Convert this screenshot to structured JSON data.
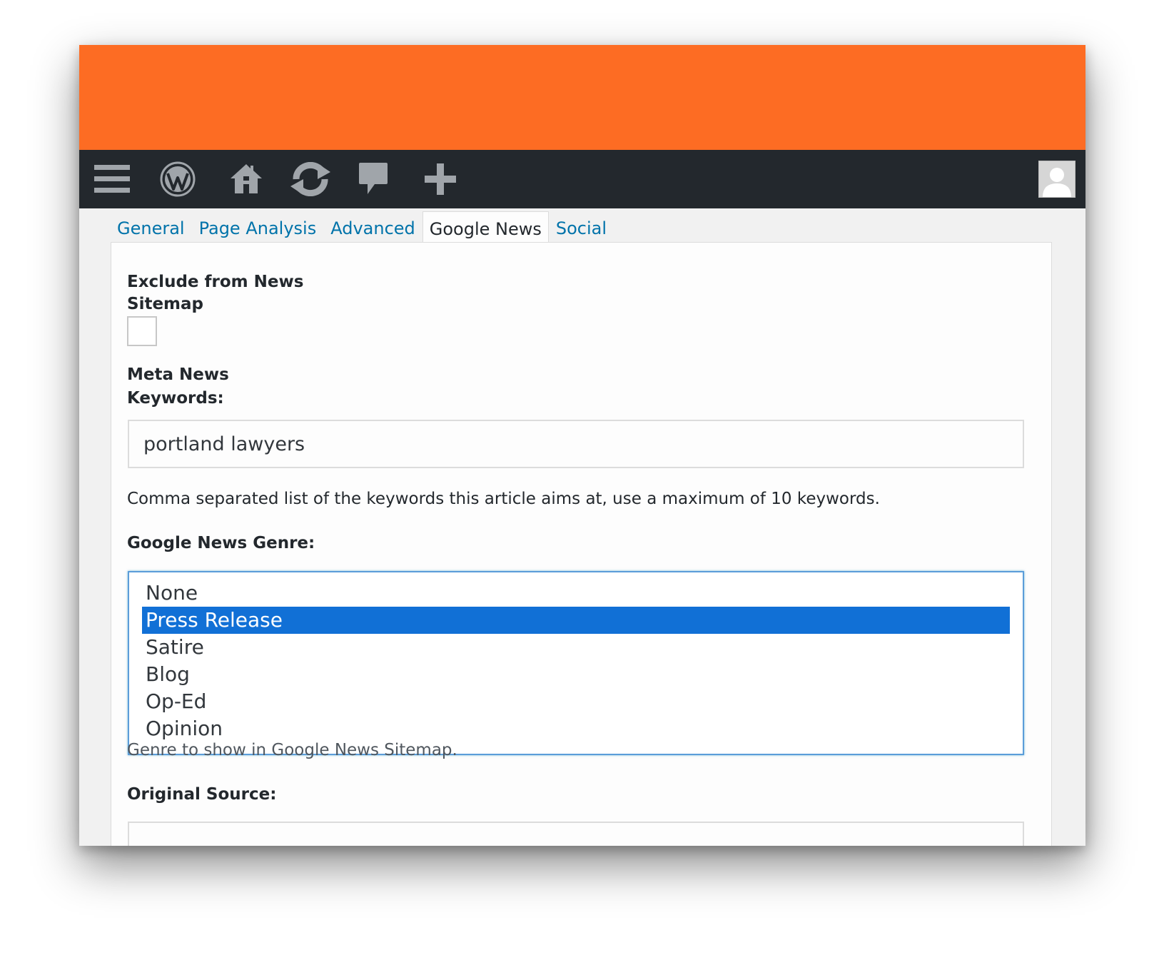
{
  "theme": {
    "brand_orange": "#fd6c23",
    "admin_bar": "#23282d",
    "link_blue": "#0073aa",
    "select_blue": "#1170d6"
  },
  "admin_bar": {
    "icons": [
      "menu-icon",
      "wordpress-logo-icon",
      "home-icon",
      "updates-icon",
      "comments-icon",
      "add-new-icon"
    ],
    "avatar": "user-avatar-icon"
  },
  "tabs": [
    {
      "label": "General",
      "active": false
    },
    {
      "label": "Page Analysis",
      "active": false
    },
    {
      "label": "Advanced",
      "active": false
    },
    {
      "label": "Google News",
      "active": true
    },
    {
      "label": "Social",
      "active": false
    }
  ],
  "form": {
    "exclude_label_line1": "Exclude from News",
    "exclude_label_line2": "Sitemap",
    "exclude_checked": false,
    "keywords_label_line1": "Meta News",
    "keywords_label_line2": "Keywords:",
    "keywords_value": "portland lawyers",
    "keywords_help": "Comma separated list of the keywords this article aims at, use a maximum of 10 keywords.",
    "genre_label": "Google News Genre:",
    "genre_options": [
      "None",
      "Press Release",
      "Satire",
      "Blog",
      "Op-Ed",
      "Opinion"
    ],
    "genre_selected": "Press Release",
    "genre_help": "Genre to show in Google News Sitemap.",
    "source_label": "Original Source:"
  }
}
